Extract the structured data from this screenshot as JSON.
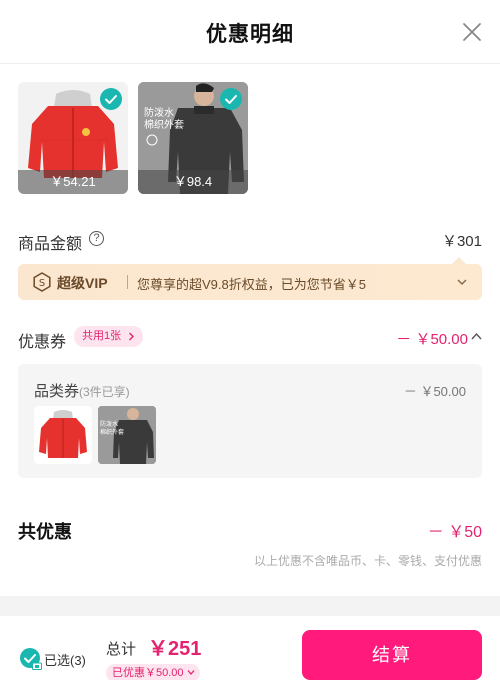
{
  "header": {
    "title": "优惠明细"
  },
  "products": [
    {
      "price": "￥54.21",
      "color": "#e5322e"
    },
    {
      "price": "￥98.4",
      "tag_lines": [
        "防泼水",
        "棉织外套"
      ],
      "color": "#3a3a3a"
    }
  ],
  "amount": {
    "label": "商品金额",
    "help": "?",
    "value": "￥301"
  },
  "vip": {
    "name": "超级VIP",
    "text": "您尊享的超V9.8折权益，已为您节省￥5"
  },
  "coupon": {
    "label": "优惠券",
    "pill": "共用1张",
    "value": "－ ￥50.00"
  },
  "coupon_detail": {
    "name": "品类券",
    "sub": "(3件已享)",
    "value": "－ ￥50.00",
    "thumb_tag_lines": [
      "防泼水",
      "棉织外套"
    ]
  },
  "total_discount": {
    "label": "共优惠",
    "value": "－ ￥50"
  },
  "note": "以上优惠不含唯品币、卡、零钱、支付优惠",
  "bottom": {
    "selected": "已选(3)",
    "total_label": "总计",
    "total_value": "￥251",
    "discount_pill": "已优惠￥50.00",
    "pay_button": "结算"
  },
  "colors": {
    "accent": "#ff1a7b",
    "pink_text": "#e3236f",
    "teal": "#19b7b0",
    "vip_bg": "#fbe7cf"
  }
}
